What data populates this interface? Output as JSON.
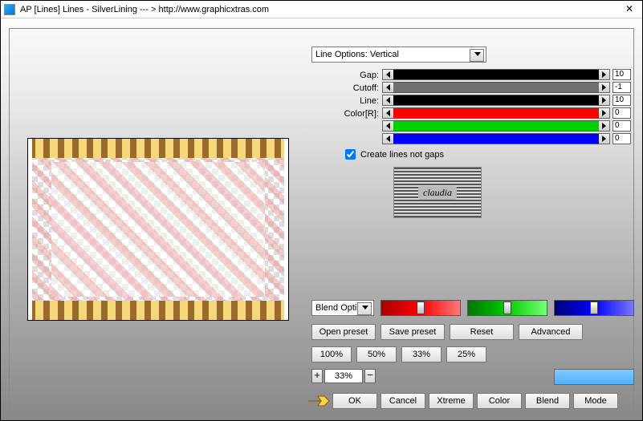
{
  "titlebar": {
    "text": "AP [Lines]  Lines - SilverLining    --- >  http://www.graphicxtras.com"
  },
  "dropdown_line_options": "Line Options: Vertical",
  "sliders": {
    "gap": {
      "label": "Gap:",
      "value": "10",
      "color": "#000000"
    },
    "cutoff": {
      "label": "Cutoff:",
      "value": "-1",
      "color": "#707070"
    },
    "line": {
      "label": "Line:",
      "value": "10",
      "color": "#000000"
    },
    "colr": {
      "label": "Color[R]:",
      "value": "0",
      "color": "#ff0000"
    },
    "colg": {
      "label": "",
      "value": "0",
      "color": "#00d000"
    },
    "colb": {
      "label": "",
      "value": "0",
      "color": "#0000ff"
    }
  },
  "checkbox": {
    "label": "Create lines not gaps"
  },
  "logo_text": "claudia",
  "blend_dd": "Blend Optio",
  "buttons": {
    "open_preset": "Open preset",
    "save_preset": "Save preset",
    "reset": "Reset",
    "advanced": "Advanced",
    "z100": "100%",
    "z50": "50%",
    "z33": "33%",
    "z25": "25%",
    "ok": "OK",
    "cancel": "Cancel",
    "xtreme": "Xtreme",
    "color": "Color",
    "blend": "Blend",
    "mode": "Mode"
  },
  "zoom": {
    "minus": "−",
    "plus": "+",
    "value": "33%"
  },
  "rgb_colors": {
    "r": "#ff0000",
    "g": "#00cc00",
    "b": "#0000ff"
  }
}
